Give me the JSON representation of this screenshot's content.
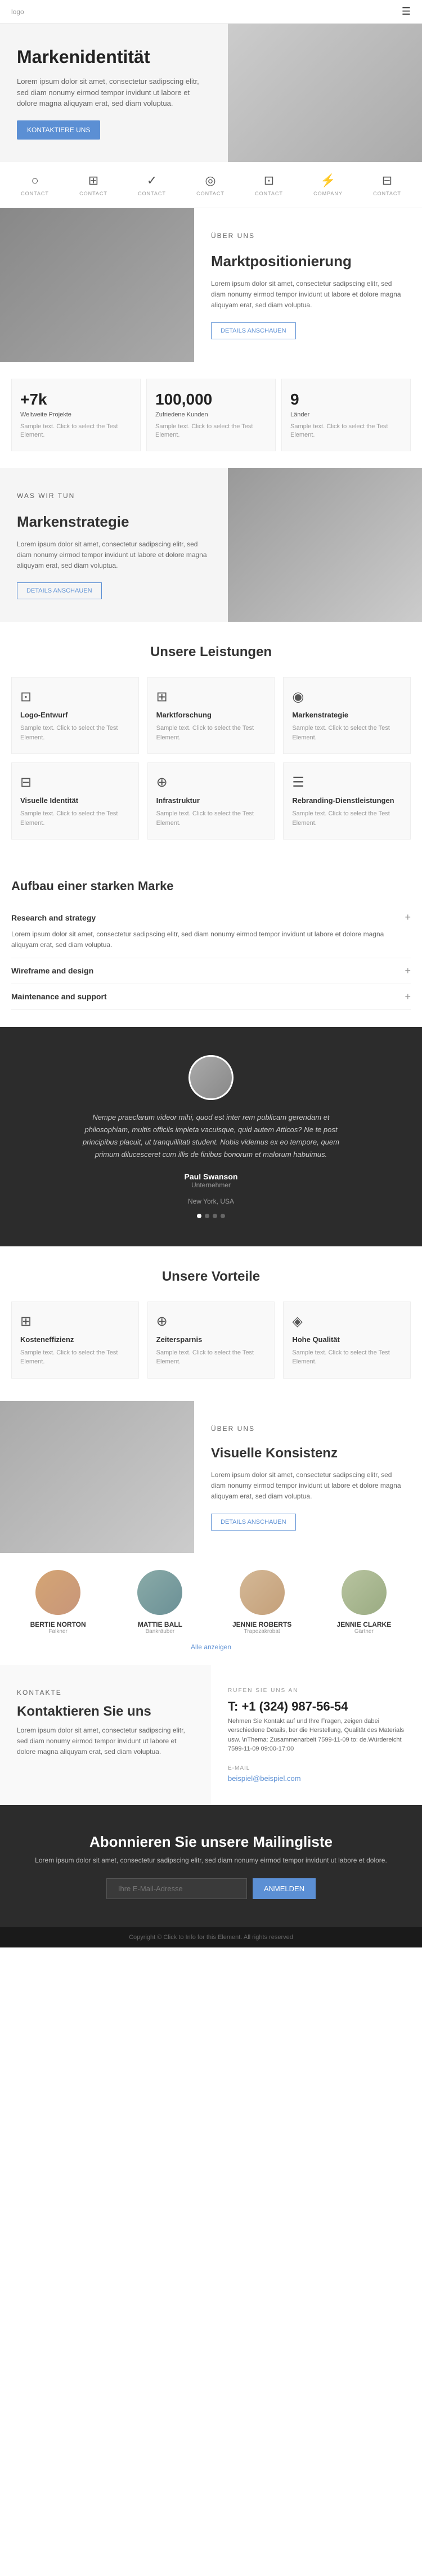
{
  "nav": {
    "logo": "logo",
    "menu_icon": "☰"
  },
  "hero": {
    "title": "Markenidentität",
    "description": "Lorem ipsum dolor sit amet, consectetur sadipscing elitr, sed diam nonumy eirmod tempor invidunt ut labore et dolore magna aliquyam erat, sed diam voluptua.",
    "btn_label": "KONTAKTIERE UNS"
  },
  "icons_row": {
    "items": [
      {
        "icon": "○",
        "label": "CONTACT"
      },
      {
        "icon": "⊞",
        "label": "CONTACT"
      },
      {
        "icon": "✓",
        "label": "CONTACT"
      },
      {
        "icon": "◎",
        "label": "CONTACT"
      },
      {
        "icon": "⊡",
        "label": "CONTACT"
      },
      {
        "icon": "⚡",
        "label": "COMPANY"
      },
      {
        "icon": "⊟",
        "label": "CONTACT"
      }
    ]
  },
  "about": {
    "label": "ÜBER UNS",
    "title": "Marktpositionierung",
    "description": "Lorem ipsum dolor sit amet, consectetur sadipscing elitr, sed diam nonumy eirmod tempor invidunt ut labore et dolore magna aliquyam erat, sed diam voluptua.",
    "btn_label": "DETAILS ANSCHAUEN"
  },
  "stats": [
    {
      "number": "+7k",
      "label": "Weltweite Projekte",
      "desc": "Sample text. Click to select the Test Element."
    },
    {
      "number": "100,000",
      "label": "Zufriedene Kunden",
      "desc": "Sample text. Click to select the Test Element."
    },
    {
      "number": "9",
      "label": "Länder",
      "desc": "Sample text. Click to select the Test Element."
    }
  ],
  "strategy": {
    "what_label": "WAS WIR TUN",
    "title": "Markenstrategie",
    "description": "Lorem ipsum dolor sit amet, consectetur sadipscing elitr, sed diam nonumy eirmod tempor invidunt ut labore et dolore magna aliquyam erat, sed diam voluptua.",
    "btn_label": "DETAILS ANSCHAUEN"
  },
  "services": {
    "title": "Unsere Leistungen",
    "items": [
      {
        "icon": "⊡",
        "title": "Logo-Entwurf",
        "desc": "Sample text. Click to select the Test Element."
      },
      {
        "icon": "⊞",
        "title": "Marktforschung",
        "desc": "Sample text. Click to select the Test Element."
      },
      {
        "icon": "◉",
        "title": "Markenstrategie",
        "desc": "Sample text. Click to select the Test Element."
      },
      {
        "icon": "⊟",
        "title": "Visuelle Identität",
        "desc": "Sample text. Click to select the Test Element."
      },
      {
        "icon": "⊕",
        "title": "Infrastruktur",
        "desc": "Sample text. Click to select the Test Element."
      },
      {
        "icon": "☰",
        "title": "Rebranding-Dienstleistungen",
        "desc": "Sample text. Click to select the Test Element."
      }
    ]
  },
  "accordion": {
    "title": "Aufbau einer starken Marke",
    "items": [
      {
        "header": "Research and strategy",
        "content": "Lorem ipsum dolor sit amet, consectetur sadipscing elitr, sed diam nonumy eirmod tempor invidunt ut labore et dolore magna aliquyam erat, sed diam voluptua.",
        "open": true
      },
      {
        "header": "Wireframe and design",
        "content": "",
        "open": false
      },
      {
        "header": "Maintenance and support",
        "content": "",
        "open": false
      }
    ]
  },
  "testimonial": {
    "text": "Nempe praeclarum videor mihi, quod est inter rem publicam gerendam et philosophiam, multis officils impleta vacuisque, quid autem Atticos? Ne te post principibus placuit, ut tranquillitati student. Nobis videmus ex eo tempore, quem primum dilucesceret cum illis de finibus bonorum et malorum habuimus.",
    "name": "Paul Swanson",
    "role": "Unternehmer",
    "sub": "New York, USA",
    "dots": [
      true,
      false,
      false,
      false
    ]
  },
  "advantages": {
    "title": "Unsere Vorteile",
    "items": [
      {
        "icon": "⊞",
        "title": "Kosteneffizienz",
        "desc": "Sample text. Click to select the Test Element."
      },
      {
        "icon": "⊕",
        "title": "Zeitersparnis",
        "desc": "Sample text. Click to select the Test Element."
      },
      {
        "icon": "◈",
        "title": "Hohe Qualität",
        "desc": "Sample text. Click to select the Test Element."
      }
    ]
  },
  "visual": {
    "label": "ÜBER UNS",
    "title": "Visuelle Konsistenz",
    "description": "Lorem ipsum dolor sit amet, consectetur sadipscing elitr, sed diam nonumy eirmod tempor invidunt ut labore et dolore magna aliquyam erat, sed diam voluptua.",
    "btn_label": "DETAILS ANSCHAUEN"
  },
  "team": {
    "members": [
      {
        "name": "BERTIE NORTON",
        "role": "Falkner"
      },
      {
        "name": "MATTIE BALL",
        "role": "Bankräuber"
      },
      {
        "name": "JENNIE ROBERTS",
        "role": "Trapezakrobat"
      },
      {
        "name": "JENNIE CLARKE",
        "role": "Gärtner"
      }
    ],
    "more_label": "Alle anzeigen"
  },
  "contact": {
    "label": "KONTAKTE",
    "title": "Kontaktieren Sie uns",
    "description": "Lorem ipsum dolor sit amet, consectetur sadipscing elitr, sed diam nonumy eirmod tempor invidunt ut labore et dolore magna aliquyam erat, sed diam voluptua.",
    "call_label": "RUFEN SIE UNS AN",
    "phone": "T: +1 (324) 987-56-54",
    "phone_desc": "Nehmen Sie Kontakt auf und Ihre Fragen, zeigen dabei verschiedene Details, ber die Herstellung, Qualität des Materials usw. \\nThema: Zusammenarbeit 7599-11-09 to: de.Würdereicht 7599-11-09 09:00-17:00",
    "email_label": "E-MAIL",
    "email": "beispiel@beispiel.com"
  },
  "newsletter": {
    "title": "Abonnieren Sie unsere Mailingliste",
    "description": "Lorem ipsum dolor sit amet, consectetur sadipscing elitr, sed diam nonumy eirmod tempor invidunt ut labore et dolore.",
    "input_placeholder": "Ihre E-Mail-Adresse",
    "btn_label": "ANMELDEN"
  },
  "footer": {
    "text": "Copyright © Click to Info for this Element. All rights reserved"
  }
}
